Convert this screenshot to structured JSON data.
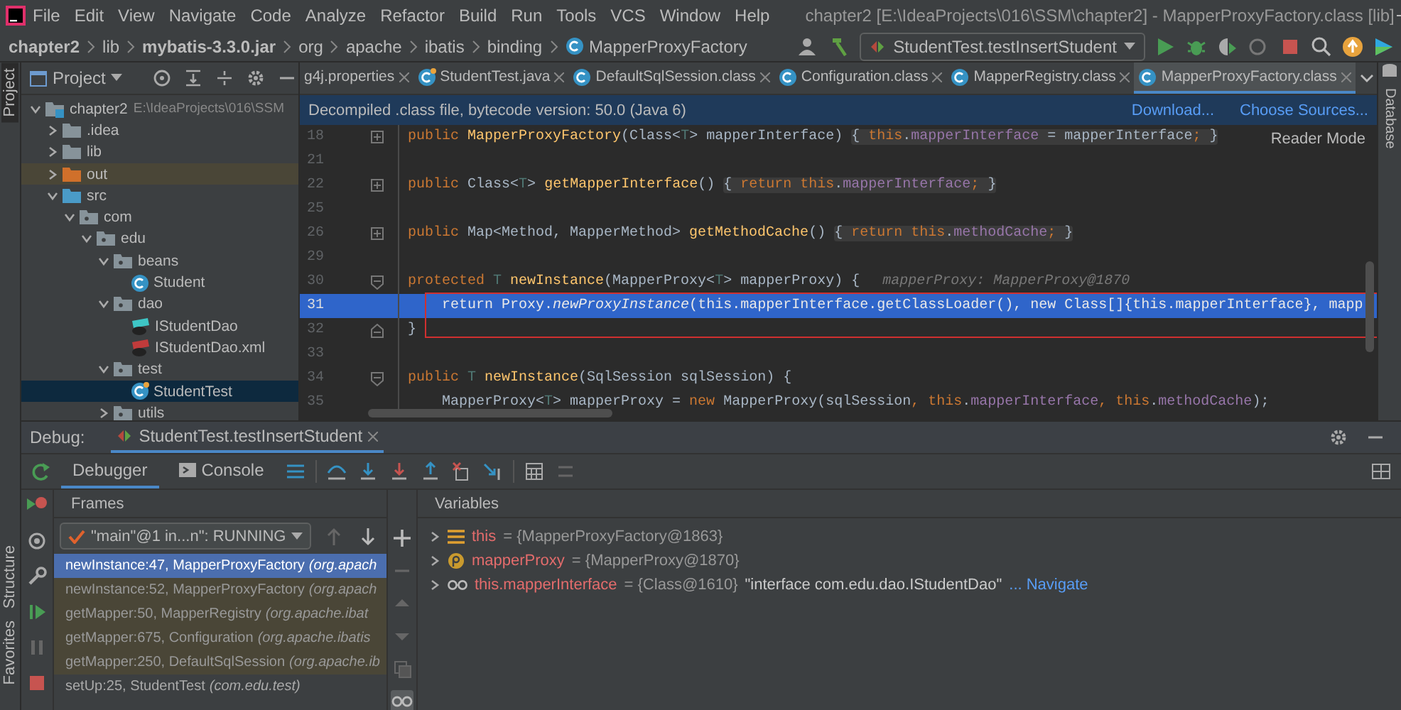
{
  "menu": [
    "File",
    "Edit",
    "View",
    "Navigate",
    "Code",
    "Analyze",
    "Refactor",
    "Build",
    "Run",
    "Tools",
    "VCS",
    "Window",
    "Help"
  ],
  "window": {
    "title": "chapter2 [E:\\IdeaProjects\\016\\SSM\\chapter2] - MapperProxyFactory.class [lib]"
  },
  "breadcrumb": [
    {
      "label": "chapter2",
      "kind": "module"
    },
    {
      "label": "lib",
      "kind": "folder"
    },
    {
      "label": "mybatis-3.3.0.jar",
      "kind": "jar"
    },
    {
      "label": "org",
      "kind": "package"
    },
    {
      "label": "apache",
      "kind": "package"
    },
    {
      "label": "ibatis",
      "kind": "package"
    },
    {
      "label": "binding",
      "kind": "package"
    },
    {
      "label": "MapperProxyFactory",
      "kind": "class"
    }
  ],
  "run_config": "StudentTest.testInsertStudent",
  "project": {
    "title": "Project",
    "side_label": "Project",
    "tree": [
      {
        "label": "chapter2",
        "note": "E:\\IdeaProjects\\016\\SSM",
        "kind": "module",
        "expanded": true,
        "selected": false,
        "children": [
          {
            "label": ".idea",
            "kind": "folder",
            "expanded": false,
            "selected": false
          },
          {
            "label": "lib",
            "kind": "folder",
            "expanded": false,
            "selected": false
          },
          {
            "label": "out",
            "kind": "excluded",
            "expanded": false,
            "selected": false
          },
          {
            "label": "src",
            "kind": "source",
            "expanded": true,
            "selected": false,
            "children": [
              {
                "label": "com",
                "kind": "package",
                "expanded": true,
                "selected": false,
                "children": [
                  {
                    "label": "edu",
                    "kind": "package",
                    "expanded": true,
                    "selected": false,
                    "children": [
                      {
                        "label": "beans",
                        "kind": "package",
                        "expanded": true,
                        "selected": false,
                        "children": [
                          {
                            "label": "Student",
                            "kind": "class",
                            "selected": false
                          }
                        ]
                      },
                      {
                        "label": "dao",
                        "kind": "package",
                        "expanded": true,
                        "selected": false,
                        "children": [
                          {
                            "label": "IStudentDao",
                            "kind": "interface",
                            "selected": false
                          },
                          {
                            "label": "IStudentDao.xml",
                            "kind": "xml",
                            "selected": false
                          }
                        ]
                      },
                      {
                        "label": "test",
                        "kind": "package",
                        "expanded": true,
                        "selected": false,
                        "children": [
                          {
                            "label": "StudentTest",
                            "kind": "test",
                            "selected": true
                          }
                        ]
                      },
                      {
                        "label": "utils",
                        "kind": "package",
                        "expanded": false,
                        "selected": false
                      }
                    ]
                  }
                ]
              }
            ]
          }
        ]
      }
    ]
  },
  "tabs": [
    {
      "label": "g4j.properties",
      "kind": "properties",
      "selected": false
    },
    {
      "label": "StudentTest.java",
      "kind": "test",
      "selected": false
    },
    {
      "label": "DefaultSqlSession.class",
      "kind": "class",
      "selected": false
    },
    {
      "label": "Configuration.class",
      "kind": "class",
      "selected": false
    },
    {
      "label": "MapperRegistry.class",
      "kind": "class",
      "selected": false
    },
    {
      "label": "MapperProxyFactory.class",
      "kind": "class",
      "selected": true
    }
  ],
  "banner": {
    "text": "Decompiled .class file, bytecode version: 50.0 (Java 6)",
    "links": [
      "Download...",
      "Choose Sources..."
    ]
  },
  "reader_mode": "Reader Mode",
  "right_label": "Database",
  "code": {
    "lines": [
      {
        "number": "18",
        "kind": "collapsed",
        "current": false,
        "segments": [
          {
            "kind": "kw",
            "text": "public "
          },
          {
            "kind": "decl",
            "text": "MapperProxyFactory"
          },
          {
            "kind": "plain",
            "text": "(Class<"
          },
          {
            "kind": "tparam",
            "text": "T"
          },
          {
            "kind": "plain",
            "text": "> mapperInterface) "
          },
          {
            "kind": "fold",
            "parts": [
              {
                "kind": "plain",
                "text": "{ "
              },
              {
                "kind": "kw",
                "text": "this"
              },
              {
                "kind": "plain",
                "text": "."
              },
              {
                "kind": "field",
                "text": "mapperInterface"
              },
              {
                "kind": "plain",
                "text": " = mapperInterface"
              },
              {
                "kind": "kw",
                "text": ";"
              },
              {
                "kind": "plain",
                "text": " }"
              }
            ]
          }
        ]
      },
      {
        "number": "21",
        "kind": "plain",
        "current": false
      },
      {
        "number": "22",
        "kind": "collapsed",
        "current": false,
        "segments": [
          {
            "kind": "kw",
            "text": "public "
          },
          {
            "kind": "plain",
            "text": "Class<"
          },
          {
            "kind": "tparam",
            "text": "T"
          },
          {
            "kind": "plain",
            "text": "> "
          },
          {
            "kind": "decl",
            "text": "getMapperInterface"
          },
          {
            "kind": "plain",
            "text": "() "
          },
          {
            "kind": "fold",
            "parts": [
              {
                "kind": "plain",
                "text": "{ "
              },
              {
                "kind": "kw",
                "text": "return this"
              },
              {
                "kind": "plain",
                "text": "."
              },
              {
                "kind": "field",
                "text": "mapperInterface"
              },
              {
                "kind": "kw",
                "text": ";"
              },
              {
                "kind": "plain",
                "text": " }"
              }
            ]
          }
        ]
      },
      {
        "number": "25",
        "kind": "plain",
        "current": false
      },
      {
        "number": "26",
        "kind": "collapsed",
        "current": false,
        "segments": [
          {
            "kind": "kw",
            "text": "public "
          },
          {
            "kind": "plain",
            "text": "Map<Method, MapperMethod> "
          },
          {
            "kind": "decl",
            "text": "getMethodCache"
          },
          {
            "kind": "plain",
            "text": "() "
          },
          {
            "kind": "fold",
            "parts": [
              {
                "kind": "plain",
                "text": "{ "
              },
              {
                "kind": "kw",
                "text": "return this"
              },
              {
                "kind": "plain",
                "text": "."
              },
              {
                "kind": "field",
                "text": "methodCache"
              },
              {
                "kind": "kw",
                "text": ";"
              },
              {
                "kind": "plain",
                "text": " }"
              }
            ]
          }
        ]
      },
      {
        "number": "29",
        "kind": "plain",
        "current": false
      },
      {
        "number": "30",
        "kind": "opening",
        "current": false,
        "segments": [
          {
            "kind": "kw",
            "text": "protected "
          },
          {
            "kind": "tparam",
            "text": "T"
          },
          {
            "kind": "decl",
            "text": " newInstance"
          },
          {
            "kind": "plain",
            "text": "(MapperProxy<"
          },
          {
            "kind": "tparam",
            "text": "T"
          },
          {
            "kind": "plain",
            "text": "> mapperProxy) {"
          }
        ],
        "hint": "mapperProxy: MapperProxy@1870"
      },
      {
        "number": "31",
        "kind": "plain",
        "current": true,
        "segments": [
          {
            "kind": "kw",
            "text": "    return "
          },
          {
            "kind": "plain",
            "text": "Proxy."
          },
          {
            "kind": "static",
            "text": "newProxyInstance"
          },
          {
            "kind": "plain",
            "text": "("
          },
          {
            "kind": "kw",
            "text": "this"
          },
          {
            "kind": "plain",
            "text": "."
          },
          {
            "kind": "field",
            "text": "mapperInterface"
          },
          {
            "kind": "plain",
            "text": ".getClassLoader()"
          },
          {
            "kind": "kw",
            "text": ", new "
          },
          {
            "kind": "plain",
            "text": "Class[]{"
          },
          {
            "kind": "kw",
            "text": "this"
          },
          {
            "kind": "plain",
            "text": "."
          },
          {
            "kind": "field",
            "text": "mapperInterface"
          },
          {
            "kind": "plain",
            "text": "}"
          },
          {
            "kind": "kw",
            "text": ", "
          },
          {
            "kind": "plain",
            "text": "mapp"
          }
        ]
      },
      {
        "number": "32",
        "kind": "closing",
        "current": false,
        "segments": [
          {
            "kind": "plain",
            "text": "}"
          }
        ]
      },
      {
        "number": "33",
        "kind": "plain",
        "current": false
      },
      {
        "number": "34",
        "kind": "opening",
        "current": false,
        "segments": [
          {
            "kind": "kw",
            "text": "public "
          },
          {
            "kind": "tparam",
            "text": "T"
          },
          {
            "kind": "decl",
            "text": " newInstance"
          },
          {
            "kind": "plain",
            "text": "(SqlSession sqlSession) {"
          }
        ]
      },
      {
        "number": "35",
        "kind": "plain",
        "current": false,
        "segments": [
          {
            "kind": "plain",
            "text": "    MapperProxy<"
          },
          {
            "kind": "tparam",
            "text": "T"
          },
          {
            "kind": "plain",
            "text": "> mapperProxy = "
          },
          {
            "kind": "kw",
            "text": "new "
          },
          {
            "kind": "plain",
            "text": "MapperProxy(sqlSession"
          },
          {
            "kind": "kw",
            "text": ", this"
          },
          {
            "kind": "plain",
            "text": "."
          },
          {
            "kind": "field",
            "text": "mapperInterface"
          },
          {
            "kind": "kw",
            "text": ", this"
          },
          {
            "kind": "plain",
            "text": "."
          },
          {
            "kind": "field",
            "text": "methodCache"
          },
          {
            "kind": "plain",
            "text": ");"
          }
        ]
      }
    ]
  },
  "debug": {
    "label": "Debug:",
    "session": "StudentTest.testInsertStudent",
    "tabs": [
      {
        "label": "Debugger",
        "selected": true
      },
      {
        "label": "Console",
        "selected": false
      }
    ],
    "side_labels": [
      "Structure",
      "Favorites"
    ],
    "frames_title": "Frames",
    "thread": "\"main\"@1 in...n\": RUNNING",
    "frames": [
      {
        "method": "newInstance:47, MapperProxyFactory",
        "package": "(org.apach",
        "selected": true,
        "library": true
      },
      {
        "method": "newInstance:52, MapperProxyFactory",
        "package": "(org.apach",
        "selected": false,
        "library": true
      },
      {
        "method": "getMapper:50, MapperRegistry",
        "package": "(org.apache.ibat",
        "selected": false,
        "library": true
      },
      {
        "method": "getMapper:675, Configuration",
        "package": "(org.apache.ibatis",
        "selected": false,
        "library": true
      },
      {
        "method": "getMapper:250, DefaultSqlSession",
        "package": "(org.apache.ib",
        "selected": false,
        "library": true
      },
      {
        "method": "setUp:25, StudentTest",
        "package": "(com.edu.test)",
        "selected": false,
        "library": false
      }
    ],
    "variables_title": "Variables",
    "variables": [
      {
        "kind": "field",
        "name": "this",
        "value": "= {MapperProxyFactory@1863}"
      },
      {
        "kind": "param",
        "name": "mapperProxy",
        "value": "= {MapperProxy@1870}"
      },
      {
        "kind": "watch",
        "name": "this.mapperInterface",
        "value": "= {Class@1610}",
        "string": "\"interface com.edu.dao.IStudentDao\"",
        "link": "... Navigate"
      }
    ]
  }
}
